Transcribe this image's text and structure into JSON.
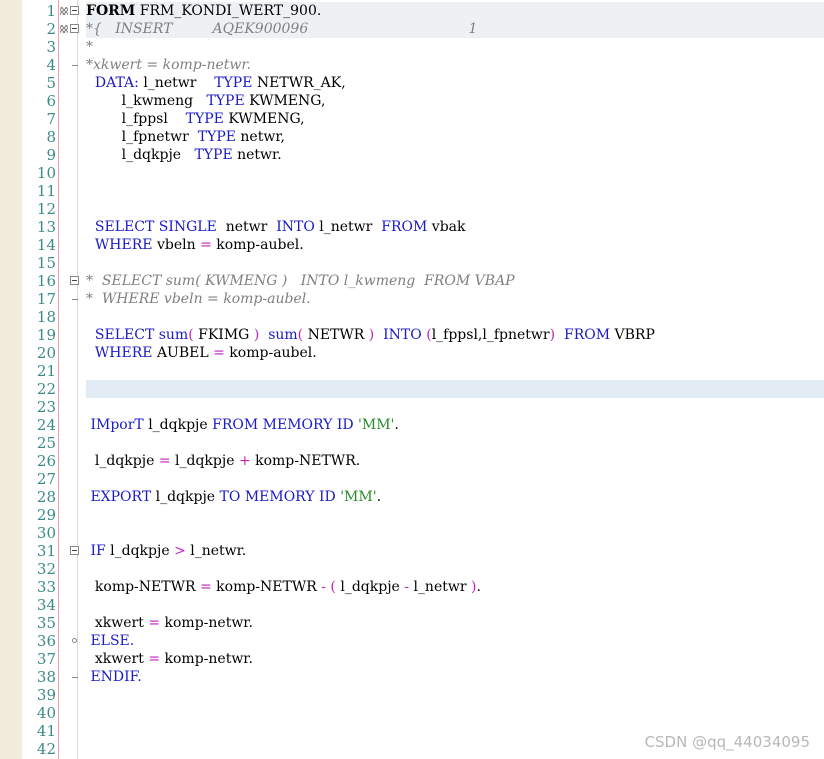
{
  "editor": {
    "watermark": "CSDN @qq_44034095",
    "lines": [
      [
        [
          "kw-bold",
          "FORM"
        ],
        [
          "id",
          " FRM_KONDI_WERT_900."
        ]
      ],
      [
        [
          "cm",
          "*{   INSERT         AQEK900096                                    1"
        ]
      ],
      [
        [
          "cm",
          "*"
        ]
      ],
      [
        [
          "cm",
          "*xkwert = komp-netwr."
        ]
      ],
      [
        [
          "id",
          "  "
        ],
        [
          "kw",
          "DATA:"
        ],
        [
          "id",
          " l_netwr    "
        ],
        [
          "kw",
          "TYPE"
        ],
        [
          "id",
          " NETWR_AK,"
        ]
      ],
      [
        [
          "id",
          "        l_kwmeng   "
        ],
        [
          "kw",
          "TYPE"
        ],
        [
          "id",
          " KWMENG,"
        ]
      ],
      [
        [
          "id",
          "        l_fppsl    "
        ],
        [
          "kw",
          "TYPE"
        ],
        [
          "id",
          " KWMENG,"
        ]
      ],
      [
        [
          "id",
          "        l_fpnetwr  "
        ],
        [
          "kw",
          "TYPE"
        ],
        [
          "id",
          " netwr,"
        ]
      ],
      [
        [
          "id",
          "        l_dqkpje   "
        ],
        [
          "kw",
          "TYPE"
        ],
        [
          "id",
          " netwr."
        ]
      ],
      [],
      [],
      [],
      [
        [
          "id",
          "  "
        ],
        [
          "kw",
          "SELECT SINGLE"
        ],
        [
          "id",
          "  netwr  "
        ],
        [
          "kw",
          "INTO"
        ],
        [
          "id",
          " l_netwr  "
        ],
        [
          "kw",
          "FROM"
        ],
        [
          "id",
          " vbak"
        ]
      ],
      [
        [
          "id",
          "  "
        ],
        [
          "kw",
          "WHERE"
        ],
        [
          "id",
          " vbeln "
        ],
        [
          "op",
          "="
        ],
        [
          "id",
          " komp-aubel."
        ]
      ],
      [],
      [
        [
          "cm",
          "*  SELECT sum( KWMENG )   INTO l_kwmeng  FROM VBAP"
        ]
      ],
      [
        [
          "cm",
          "*  WHERE vbeln = komp-aubel."
        ]
      ],
      [],
      [
        [
          "id",
          "  "
        ],
        [
          "kw",
          "SELECT sum"
        ],
        [
          "op",
          "("
        ],
        [
          "id",
          " FKIMG "
        ],
        [
          "op",
          ")"
        ],
        [
          "id",
          "  "
        ],
        [
          "kw",
          "sum"
        ],
        [
          "op",
          "("
        ],
        [
          "id",
          " NETWR "
        ],
        [
          "op",
          ")"
        ],
        [
          "id",
          "  "
        ],
        [
          "kw",
          "INTO"
        ],
        [
          "id",
          " "
        ],
        [
          "op",
          "("
        ],
        [
          "id",
          "l_fppsl,l_fpnetwr"
        ],
        [
          "op",
          ")"
        ],
        [
          "id",
          "  "
        ],
        [
          "kw",
          "FROM"
        ],
        [
          "id",
          " VBRP"
        ]
      ],
      [
        [
          "id",
          "  "
        ],
        [
          "kw",
          "WHERE"
        ],
        [
          "id",
          " AUBEL "
        ],
        [
          "op",
          "="
        ],
        [
          "id",
          " komp-aubel."
        ]
      ],
      [],
      [],
      [],
      [
        [
          "id",
          " "
        ],
        [
          "kw",
          "IMporT"
        ],
        [
          "id",
          " l_dqkpje "
        ],
        [
          "kw",
          "FROM MEMORY ID"
        ],
        [
          "id",
          " "
        ],
        [
          "str",
          "'MM'"
        ],
        [
          "id",
          "."
        ]
      ],
      [],
      [
        [
          "id",
          "  l_dqkpje "
        ],
        [
          "op",
          "="
        ],
        [
          "id",
          " l_dqkpje "
        ],
        [
          "op",
          "+"
        ],
        [
          "id",
          " komp-NETWR."
        ]
      ],
      [],
      [
        [
          "id",
          " "
        ],
        [
          "kw",
          "EXPORT"
        ],
        [
          "id",
          " l_dqkpje "
        ],
        [
          "kw",
          "TO MEMORY ID"
        ],
        [
          "id",
          " "
        ],
        [
          "str",
          "'MM'"
        ],
        [
          "id",
          "."
        ]
      ],
      [],
      [],
      [
        [
          "id",
          " "
        ],
        [
          "kw",
          "IF"
        ],
        [
          "id",
          " l_dqkpje "
        ],
        [
          "op",
          ">"
        ],
        [
          "id",
          " l_netwr."
        ]
      ],
      [],
      [
        [
          "id",
          "  komp-NETWR "
        ],
        [
          "op",
          "="
        ],
        [
          "id",
          " komp-NETWR "
        ],
        [
          "op",
          "-"
        ],
        [
          "id",
          " "
        ],
        [
          "op",
          "("
        ],
        [
          "id",
          " l_dqkpje "
        ],
        [
          "op",
          "-"
        ],
        [
          "id",
          " l_netwr "
        ],
        [
          "op",
          ")"
        ],
        [
          "id",
          "."
        ]
      ],
      [],
      [
        [
          "id",
          "  xkwert "
        ],
        [
          "op",
          "="
        ],
        [
          "id",
          " komp-netwr."
        ]
      ],
      [
        [
          "id",
          " "
        ],
        [
          "kw",
          "ELSE."
        ]
      ],
      [
        [
          "id",
          "  xkwert "
        ],
        [
          "op",
          "="
        ],
        [
          "id",
          " komp-netwr."
        ]
      ],
      [
        [
          "id",
          " "
        ],
        [
          "kw",
          "ENDIF."
        ]
      ],
      [],
      [],
      [],
      []
    ]
  }
}
